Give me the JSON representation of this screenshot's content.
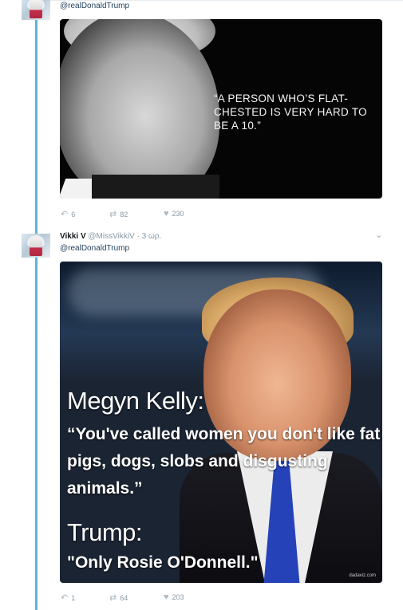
{
  "tweet1": {
    "reply_to": "@realDonaldTrump",
    "image_quote": "“A PERSON WHO’S FLAT-CHESTED IS VERY HARD TO BE A 10.”",
    "replies": "6",
    "retweets": "82",
    "likes": "230"
  },
  "tweet2": {
    "name": "Vikki V",
    "handle": "@MissVikkiV",
    "time": "· 3 ωρ.",
    "reply_to": "@realDonaldTrump",
    "image": {
      "speaker1": "Megyn Kelly:",
      "quote1": "“You've called women you don't like fat pigs, dogs, slobs and disgusting animals.”",
      "speaker2": "Trump:",
      "quote2": "\"Only Rosie O'Donnell.\"",
      "credit": "dadaviz.com"
    },
    "replies": "1",
    "retweets": "64",
    "likes": "203"
  },
  "icons": {
    "reply": "reply-icon",
    "retweet": "retweet-icon",
    "like": "heart-icon",
    "caret": "chevron-down-icon"
  },
  "colors": {
    "thread_line": "#5fb3d8",
    "action_gray": "#aab8c2",
    "link": "#1f3f5b"
  }
}
